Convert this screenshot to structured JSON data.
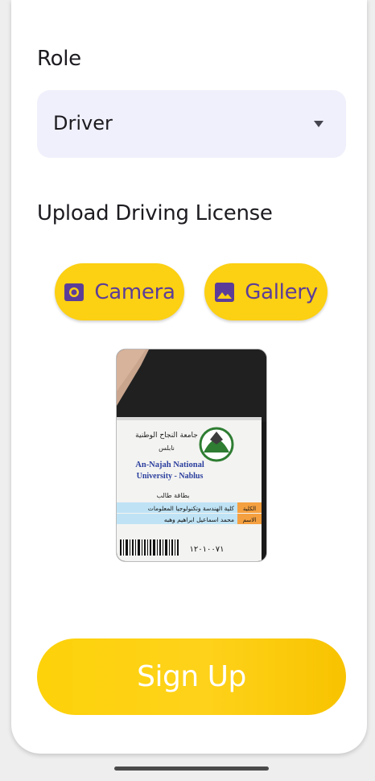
{
  "form": {
    "role_label": "Role",
    "role_value": "Driver",
    "upload_label": "Upload Driving License",
    "camera_label": "Camera",
    "gallery_label": "Gallery",
    "signup_label": "Sign Up"
  },
  "license_card": {
    "university_ar": "جامعة النجاح الوطنية",
    "city_ar": "نابلس",
    "university_en_1": "An-Najah National",
    "university_en_2": "University - Nablus",
    "card_type_ar": "بطاقة طالب",
    "faculty_label_ar": "الكلية",
    "faculty_value_ar": "كلية الهندسة وتكنولوجيا المعلومات",
    "name_label_ar": "الاسم",
    "name_value_ar": "محمد اسماعيل ابراهيم وهبه",
    "id_number": "١٢٠١٠٠٧١"
  },
  "icons": {
    "camera": "camera-icon",
    "gallery": "image-icon",
    "dropdown": "dropdown-arrow-icon"
  },
  "colors": {
    "accent_yellow": "#FCD013",
    "button_text_purple": "#5B3D99",
    "select_background": "#EFF0FB"
  }
}
